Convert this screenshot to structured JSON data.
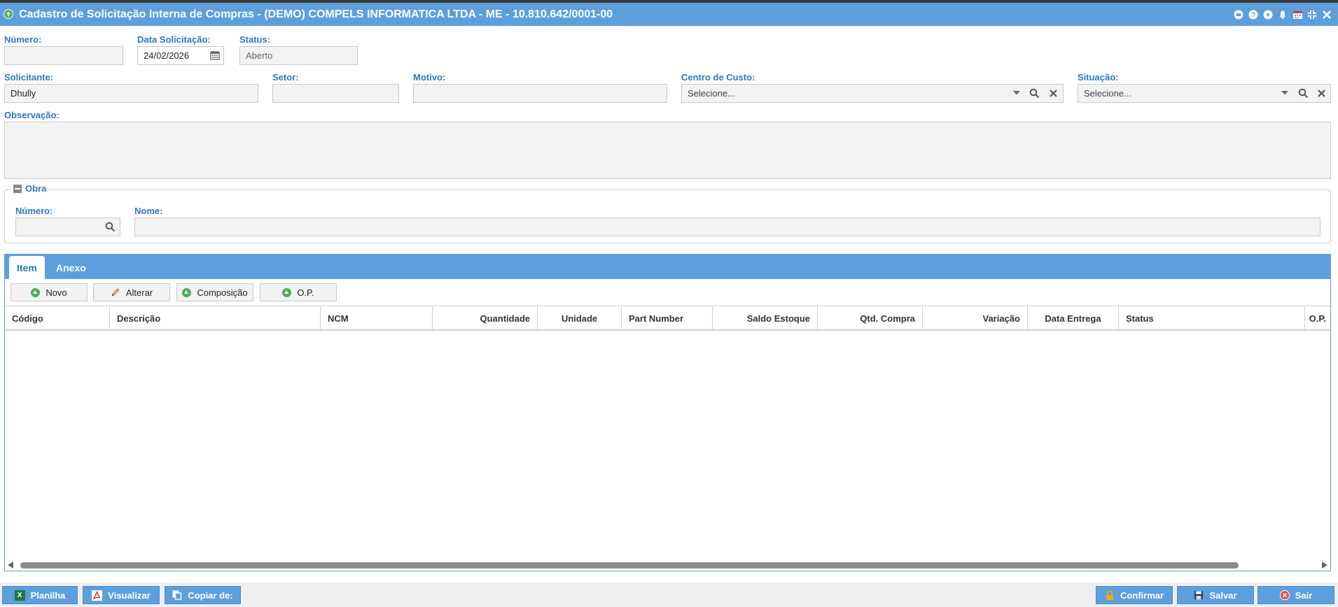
{
  "window": {
    "title": "Cadastro de Solicitação Interna de Compras - (DEMO) COMPELS INFORMATICA LTDA - ME - 10.810.642/0001-00"
  },
  "form": {
    "numero": {
      "label": "Número:",
      "value": ""
    },
    "data_solicitacao": {
      "label": "Data Solicitação:",
      "value": "24/02/2026"
    },
    "status": {
      "label": "Status:",
      "value": "Aberto"
    },
    "solicitante": {
      "label": "Solicitante:",
      "value": "Dhully"
    },
    "setor": {
      "label": "Setor:",
      "value": ""
    },
    "motivo": {
      "label": "Motivo:",
      "value": ""
    },
    "centro_custo": {
      "label": "Centro de Custo:",
      "placeholder": "Selecione..."
    },
    "situacao": {
      "label": "Situação:",
      "placeholder": "Selecione..."
    },
    "observacao": {
      "label": "Observação:",
      "value": ""
    }
  },
  "obra": {
    "legend": "Obra",
    "numero": {
      "label": "Número:",
      "value": ""
    },
    "nome": {
      "label": "Nome:",
      "value": ""
    }
  },
  "tabs": [
    {
      "label": "Item",
      "active": true
    },
    {
      "label": "Anexo",
      "active": false
    }
  ],
  "toolbar": {
    "novo": "Novo",
    "alterar": "Alterar",
    "composicao": "Composição",
    "op": "O.P."
  },
  "table": {
    "columns": [
      "Código",
      "Descrição",
      "NCM",
      "Quantidade",
      "Unidade",
      "Part Number",
      "Saldo Estoque",
      "Qtd. Compra",
      "Variação",
      "Data Entrega",
      "Status",
      "O.P."
    ],
    "rows": []
  },
  "footer": {
    "planilha": "Planilha",
    "visualizar": "Visualizar",
    "copiar": "Copiar de:",
    "confirmar": "Confirmar",
    "salvar": "Salvar",
    "sair": "Sair"
  },
  "colors": {
    "accent": "#5d9fdc",
    "label": "#2a78c6",
    "excel": "#1d7a3e",
    "pdf": "#d9362b",
    "lock": "#f0a81c",
    "exit": "#e24b4b"
  }
}
